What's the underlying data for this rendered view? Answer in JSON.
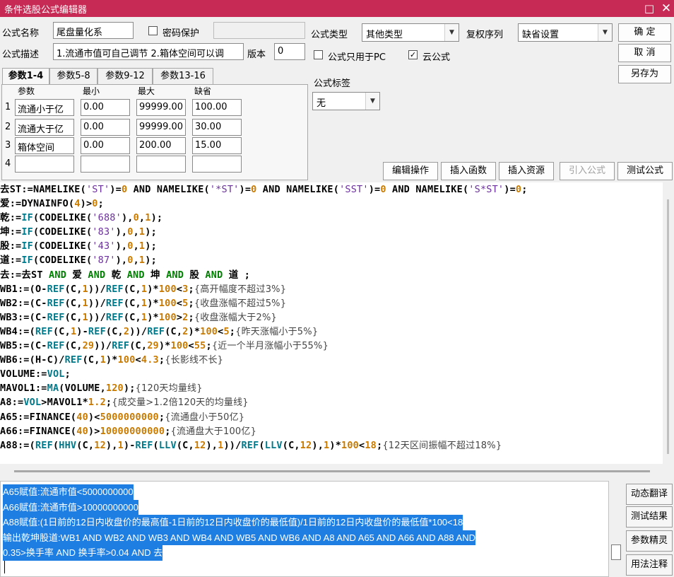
{
  "window": {
    "title": "条件选股公式编辑器",
    "max_glyph": "□",
    "close_glyph": "✕"
  },
  "form": {
    "name_label": "公式名称",
    "name_value": "尾盘量化系",
    "password_label": "密码保护",
    "password_checked": false,
    "desc_label": "公式描述",
    "desc_value": "1.流通市值可自己调节  2.箱体空间可以调",
    "version_label": "版本",
    "version_value": "0",
    "type_label": "公式类型",
    "type_value": "其他类型",
    "fuquan_label": "复权序列",
    "fuquan_value": "缺省设置",
    "pc_only_label": "公式只用于PC",
    "pc_only_checked": false,
    "cloud_label": "云公式",
    "cloud_checked": true,
    "tag_label": "公式标签",
    "tag_value": "无"
  },
  "right_buttons": {
    "ok": "确  定",
    "cancel": "取  消",
    "save_as": "另存为"
  },
  "tabs": [
    "参数1-4",
    "参数5-8",
    "参数9-12",
    "参数13-16"
  ],
  "param_headers": {
    "name": "参数",
    "min": "最小",
    "max": "最大",
    "default": "缺省"
  },
  "params": [
    {
      "row": "1",
      "name": "流通小于亿",
      "min": "0.00",
      "max": "99999.00",
      "default": "100.00"
    },
    {
      "row": "2",
      "name": "流通大于亿",
      "min": "0.00",
      "max": "99999.00",
      "default": "30.00"
    },
    {
      "row": "3",
      "name": "箱体空间",
      "min": "0.00",
      "max": "200.00",
      "default": "15.00"
    },
    {
      "row": "4",
      "name": "",
      "min": "",
      "max": "",
      "default": ""
    }
  ],
  "toolbar": {
    "edit": "编辑操作",
    "insert_func": "插入函数",
    "insert_res": "插入资源",
    "import": "引入公式",
    "test": "测试公式"
  },
  "code_lines": [
    [
      [
        "t",
        "去ST:=NAMELIKE("
      ],
      [
        "s",
        "'ST'"
      ],
      [
        "t",
        ")="
      ],
      [
        "n",
        "0"
      ],
      [
        "t",
        " AND NAMELIKE("
      ],
      [
        "s",
        "'*ST'"
      ],
      [
        "t",
        ")="
      ],
      [
        "n",
        "0"
      ],
      [
        "t",
        " AND NAMELIKE("
      ],
      [
        "s",
        "'SST'"
      ],
      [
        "t",
        ")="
      ],
      [
        "n",
        "0"
      ],
      [
        "t",
        " AND NAMELIKE("
      ],
      [
        "s",
        "'S*ST'"
      ],
      [
        "t",
        ")="
      ],
      [
        "n",
        "0"
      ],
      [
        "t",
        ";"
      ]
    ],
    [
      [
        "t",
        "爱:=DYNAINFO("
      ],
      [
        "n",
        "4"
      ],
      [
        "t",
        ")>"
      ],
      [
        "n",
        "0"
      ],
      [
        "t",
        ";"
      ]
    ],
    [
      [
        "t",
        "乾:="
      ],
      [
        "f",
        "IF"
      ],
      [
        "t",
        "(CODELIKE("
      ],
      [
        "s",
        "'688'"
      ],
      [
        "t",
        "),"
      ],
      [
        "n",
        "0"
      ],
      [
        "t",
        ","
      ],
      [
        "n",
        "1"
      ],
      [
        "t",
        ");"
      ]
    ],
    [
      [
        "t",
        "坤:="
      ],
      [
        "f",
        "IF"
      ],
      [
        "t",
        "(CODELIKE("
      ],
      [
        "s",
        "'83'"
      ],
      [
        "t",
        "),"
      ],
      [
        "n",
        "0"
      ],
      [
        "t",
        ","
      ],
      [
        "n",
        "1"
      ],
      [
        "t",
        ");"
      ]
    ],
    [
      [
        "t",
        "股:="
      ],
      [
        "f",
        "IF"
      ],
      [
        "t",
        "(CODELIKE("
      ],
      [
        "s",
        "'43'"
      ],
      [
        "t",
        "),"
      ],
      [
        "n",
        "0"
      ],
      [
        "t",
        ","
      ],
      [
        "n",
        "1"
      ],
      [
        "t",
        ");"
      ]
    ],
    [
      [
        "t",
        "道:="
      ],
      [
        "f",
        "IF"
      ],
      [
        "t",
        "(CODELIKE("
      ],
      [
        "s",
        "'87'"
      ],
      [
        "t",
        "),"
      ],
      [
        "n",
        "0"
      ],
      [
        "t",
        ","
      ],
      [
        "n",
        "1"
      ],
      [
        "t",
        ");"
      ]
    ],
    [
      [
        "t",
        "去:=去ST "
      ],
      [
        "k",
        "AND"
      ],
      [
        "t",
        " 爱 "
      ],
      [
        "k",
        "AND"
      ],
      [
        "t",
        " 乾 "
      ],
      [
        "k",
        "AND"
      ],
      [
        "t",
        " 坤 "
      ],
      [
        "k",
        "AND"
      ],
      [
        "t",
        " 股 "
      ],
      [
        "k",
        "AND"
      ],
      [
        "t",
        " 道 ;"
      ]
    ],
    [
      [
        "t",
        "WB1:=(O-"
      ],
      [
        "f",
        "REF"
      ],
      [
        "t",
        "(C,"
      ],
      [
        "n",
        "1"
      ],
      [
        "t",
        "))/"
      ],
      [
        "f",
        "REF"
      ],
      [
        "t",
        "(C,"
      ],
      [
        "n",
        "1"
      ],
      [
        "t",
        ")*"
      ],
      [
        "n",
        "100"
      ],
      [
        "t",
        "<"
      ],
      [
        "n",
        "3"
      ],
      [
        "t",
        ";"
      ],
      [
        "c",
        "{高开幅度不超过3%}"
      ]
    ],
    [
      [
        "t",
        "WB2:=(C-"
      ],
      [
        "f",
        "REF"
      ],
      [
        "t",
        "(C,"
      ],
      [
        "n",
        "1"
      ],
      [
        "t",
        "))/"
      ],
      [
        "f",
        "REF"
      ],
      [
        "t",
        "(C,"
      ],
      [
        "n",
        "1"
      ],
      [
        "t",
        ")*"
      ],
      [
        "n",
        "100"
      ],
      [
        "t",
        "<"
      ],
      [
        "n",
        "5"
      ],
      [
        "t",
        ";"
      ],
      [
        "c",
        "{收盘涨幅不超过5%}"
      ]
    ],
    [
      [
        "t",
        "WB3:=(C-"
      ],
      [
        "f",
        "REF"
      ],
      [
        "t",
        "(C,"
      ],
      [
        "n",
        "1"
      ],
      [
        "t",
        "))/"
      ],
      [
        "f",
        "REF"
      ],
      [
        "t",
        "(C,"
      ],
      [
        "n",
        "1"
      ],
      [
        "t",
        ")*"
      ],
      [
        "n",
        "100"
      ],
      [
        "t",
        ">"
      ],
      [
        "n",
        "2"
      ],
      [
        "t",
        ";"
      ],
      [
        "c",
        "{收盘涨幅大于2%}"
      ]
    ],
    [
      [
        "t",
        "WB4:=("
      ],
      [
        "f",
        "REF"
      ],
      [
        "t",
        "(C,"
      ],
      [
        "n",
        "1"
      ],
      [
        "t",
        ")-"
      ],
      [
        "f",
        "REF"
      ],
      [
        "t",
        "(C,"
      ],
      [
        "n",
        "2"
      ],
      [
        "t",
        "))/"
      ],
      [
        "f",
        "REF"
      ],
      [
        "t",
        "(C,"
      ],
      [
        "n",
        "2"
      ],
      [
        "t",
        ")*"
      ],
      [
        "n",
        "100"
      ],
      [
        "t",
        "<"
      ],
      [
        "n",
        "5"
      ],
      [
        "t",
        ";"
      ],
      [
        "c",
        "{昨天涨幅小于5%}"
      ]
    ],
    [
      [
        "t",
        "WB5:=(C-"
      ],
      [
        "f",
        "REF"
      ],
      [
        "t",
        "(C,"
      ],
      [
        "n",
        "29"
      ],
      [
        "t",
        "))/"
      ],
      [
        "f",
        "REF"
      ],
      [
        "t",
        "(C,"
      ],
      [
        "n",
        "29"
      ],
      [
        "t",
        ")*"
      ],
      [
        "n",
        "100"
      ],
      [
        "t",
        "<"
      ],
      [
        "n",
        "55"
      ],
      [
        "t",
        ";"
      ],
      [
        "c",
        "{近一个半月涨幅小于55%}"
      ]
    ],
    [
      [
        "t",
        "WB6:=(H-C)/"
      ],
      [
        "f",
        "REF"
      ],
      [
        "t",
        "(C,"
      ],
      [
        "n",
        "1"
      ],
      [
        "t",
        ")*"
      ],
      [
        "n",
        "100"
      ],
      [
        "t",
        "<"
      ],
      [
        "n",
        "4.3"
      ],
      [
        "t",
        ";"
      ],
      [
        "c",
        "{长影线不长}"
      ]
    ],
    [
      [
        "t",
        "VOLUME:="
      ],
      [
        "f",
        "VOL"
      ],
      [
        "t",
        ";"
      ]
    ],
    [
      [
        "t",
        "MAVOL1:="
      ],
      [
        "f",
        "MA"
      ],
      [
        "t",
        "(VOLUME,"
      ],
      [
        "n",
        "120"
      ],
      [
        "t",
        ");"
      ],
      [
        "c",
        "{120天均量线}"
      ]
    ],
    [
      [
        "t",
        "A8:="
      ],
      [
        "f",
        "VOL"
      ],
      [
        "t",
        ">MAVOL1*"
      ],
      [
        "n",
        "1.2"
      ],
      [
        "t",
        ";"
      ],
      [
        "c",
        "{成交量>1.2倍120天的均量线}"
      ]
    ],
    [
      [
        "t",
        "A65:=FINANCE("
      ],
      [
        "n",
        "40"
      ],
      [
        "t",
        ")<"
      ],
      [
        "n",
        "5000000000"
      ],
      [
        "t",
        ";"
      ],
      [
        "c",
        "{流通盘小于50亿}"
      ]
    ],
    [
      [
        "t",
        "A66:=FINANCE("
      ],
      [
        "n",
        "40"
      ],
      [
        "t",
        ")>"
      ],
      [
        "n",
        "10000000000"
      ],
      [
        "t",
        ";"
      ],
      [
        "c",
        "{流通盘大于100亿}"
      ]
    ],
    [
      [
        "t",
        "A88:=("
      ],
      [
        "f",
        "REF"
      ],
      [
        "t",
        "("
      ],
      [
        "f",
        "HHV"
      ],
      [
        "t",
        "(C,"
      ],
      [
        "n",
        "12"
      ],
      [
        "t",
        "),"
      ],
      [
        "n",
        "1"
      ],
      [
        "t",
        ")-"
      ],
      [
        "f",
        "REF"
      ],
      [
        "t",
        "("
      ],
      [
        "f",
        "LLV"
      ],
      [
        "t",
        "(C,"
      ],
      [
        "n",
        "12"
      ],
      [
        "t",
        "),"
      ],
      [
        "n",
        "1"
      ],
      [
        "t",
        "))/"
      ],
      [
        "f",
        "REF"
      ],
      [
        "t",
        "("
      ],
      [
        "f",
        "LLV"
      ],
      [
        "t",
        "(C,"
      ],
      [
        "n",
        "12"
      ],
      [
        "t",
        "),"
      ],
      [
        "n",
        "1"
      ],
      [
        "t",
        ")*"
      ],
      [
        "n",
        "100"
      ],
      [
        "t",
        "<"
      ],
      [
        "n",
        "18"
      ],
      [
        "t",
        ";"
      ],
      [
        "c",
        "{12天区间振幅不超过18%}"
      ]
    ]
  ],
  "output_lines": [
    "A65赋值:流通市值<5000000000",
    "A66赋值:流通市值>10000000000",
    "A88赋值:(1日前的12日内收盘价的最高值-1日前的12日内收盘价的最低值)/1日前的12日内收盘价的最低值*100<18",
    "输出乾坤股道:WB1 AND WB2 AND WB3 AND WB4 AND  WB5  AND WB6 AND A8 AND A65 AND A66 AND A88 AND",
    "0.35>换手率 AND 换手率>0.04 AND 去"
  ],
  "side_buttons": {
    "translate": "动态翻译",
    "result": "测试结果",
    "wizard": "参数精灵",
    "help": "用法注释"
  },
  "colors": {
    "titlebar": "#c72b55",
    "selection": "#1e7ee2",
    "number": "#c87a00",
    "function": "#007a8a",
    "string": "#6b2f9c",
    "keyword": "#008000"
  }
}
